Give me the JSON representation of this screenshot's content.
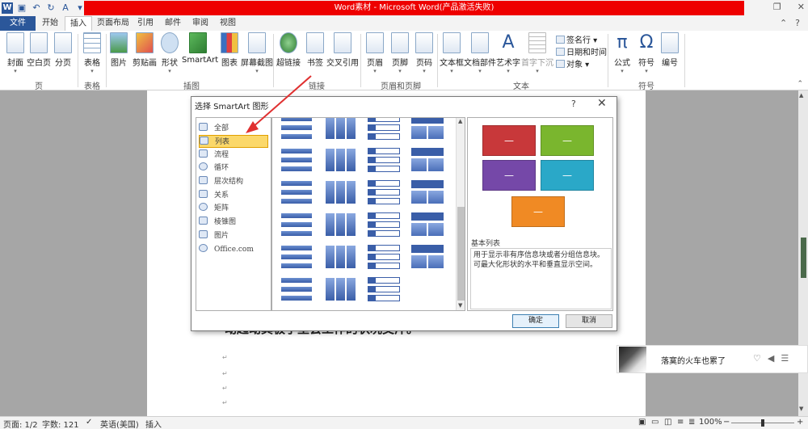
{
  "window": {
    "title": "Word素材 - Microsoft Word(产品激活失败)",
    "help_icon": "?",
    "minimize_icon": "restore-icon",
    "close_label": "✕"
  },
  "tabs": [
    "文件",
    "开始",
    "插入",
    "页面布局",
    "引用",
    "邮件",
    "审阅",
    "视图"
  ],
  "ribbon": {
    "page_group": {
      "label": "页",
      "buttons": [
        "封面",
        "空白页",
        "分页"
      ]
    },
    "table_group": {
      "label": "表格",
      "buttons": [
        "表格"
      ]
    },
    "illustration_group": {
      "label": "插图",
      "buttons": [
        "图片",
        "剪贴画",
        "形状",
        "SmartArt",
        "图表",
        "屏幕截图"
      ]
    },
    "link_group": {
      "label": "链接",
      "buttons": [
        "超链接",
        "书签",
        "交叉引用"
      ]
    },
    "header_group": {
      "label": "页眉和页脚",
      "buttons": [
        "页眉",
        "页脚",
        "页码"
      ]
    },
    "text_group": {
      "label": "文本",
      "buttons": [
        "文本框",
        "文档部件",
        "艺术字",
        "首字下沉"
      ],
      "small": [
        "签名行",
        "日期和时间",
        "对象"
      ]
    },
    "symbol_group": {
      "label": "符号",
      "buttons": [
        "公式",
        "符号",
        "编号"
      ]
    }
  },
  "document": {
    "visible_text": "动起动其极了里会工作的状况交斤。"
  },
  "dialog": {
    "title": "选择 SmartArt 图形",
    "help": "?",
    "categories": [
      "全部",
      "列表",
      "流程",
      "循环",
      "层次结构",
      "关系",
      "矩阵",
      "棱锥图",
      "图片",
      "Office.com"
    ],
    "selected_category": "列表",
    "preview_name": "基本列表",
    "preview_desc": "用于显示非有序信息块或者分组信息块。可最大化形状的水平和垂直显示空间。",
    "preview_colors": [
      "#c8383a",
      "#7ab62e",
      "#7548a8",
      "#2aa8c8",
      "#f08a24"
    ],
    "box_text": "—",
    "ok_label": "确定",
    "cancel_label": "取消"
  },
  "popup": {
    "text": "落寞的火车也累了"
  },
  "status": {
    "page": "页面: 1/2",
    "words": "字数: 121",
    "language": "英语(美国)",
    "mode": "插入",
    "zoom": "100%",
    "zoom_minus": "−",
    "zoom_plus": "+"
  }
}
